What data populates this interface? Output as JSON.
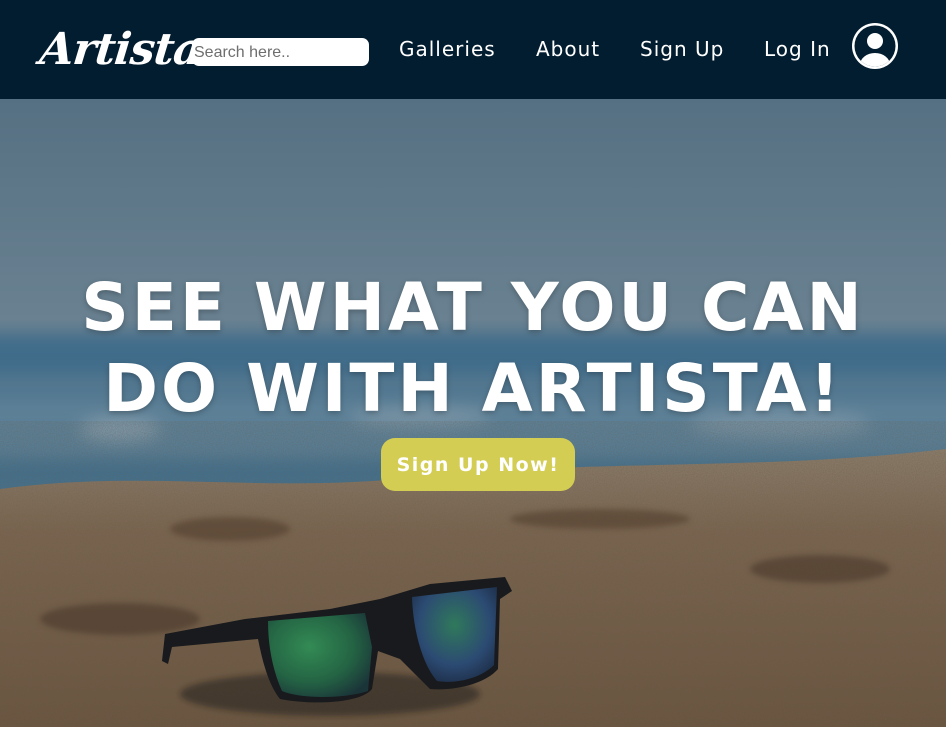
{
  "header": {
    "logo_text": "Artista",
    "background_color": "#031d30",
    "search": {
      "placeholder": "Search here..",
      "value": ""
    },
    "nav": {
      "galleries": "Galleries",
      "about": "About",
      "sign_up": "Sign Up",
      "log_in": "Log In"
    },
    "avatar_icon": "user-circle-icon"
  },
  "hero": {
    "background_image": "sunglasses on sandy beach, blurred ocean",
    "title_line1": "SEE WHAT YOU CAN",
    "title_line2": "DO WITH ARTISTA!",
    "cta_label": "Sign Up Now!",
    "cta_color": "#d4cd53"
  }
}
